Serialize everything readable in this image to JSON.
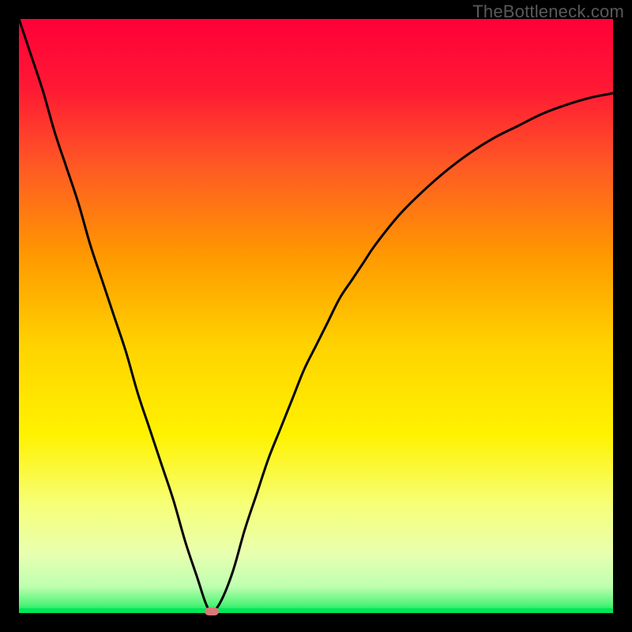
{
  "watermark": "TheBottleneck.com",
  "chart_data": {
    "type": "line",
    "title": "",
    "xlabel": "",
    "ylabel": "",
    "xlim": [
      0,
      100
    ],
    "ylim": [
      0,
      100
    ],
    "grid": false,
    "series": [
      {
        "name": "bottleneck-curve",
        "x": [
          0,
          2,
          4,
          6,
          8,
          10,
          12,
          14,
          16,
          18,
          20,
          22,
          24,
          26,
          28,
          30,
          31.5,
          32.5,
          34,
          36,
          38,
          40,
          42,
          44,
          46,
          48,
          50,
          52,
          54,
          56,
          58,
          60,
          64,
          68,
          72,
          76,
          80,
          84,
          88,
          92,
          96,
          100
        ],
        "y": [
          100,
          94,
          88,
          81,
          75,
          69,
          62,
          56,
          50,
          44,
          37,
          31,
          25,
          19,
          12,
          6,
          1.5,
          0.2,
          2,
          7,
          14,
          20,
          26,
          31,
          36,
          41,
          45,
          49,
          53,
          56,
          59,
          62,
          67,
          71,
          74.5,
          77.5,
          80,
          82,
          84,
          85.5,
          86.7,
          87.5
        ]
      }
    ],
    "gradient_stops": [
      {
        "pos": 0.0,
        "color": "#ff0038"
      },
      {
        "pos": 0.12,
        "color": "#ff1a34"
      },
      {
        "pos": 0.25,
        "color": "#ff5a24"
      },
      {
        "pos": 0.4,
        "color": "#ff9900"
      },
      {
        "pos": 0.55,
        "color": "#ffd300"
      },
      {
        "pos": 0.7,
        "color": "#fff200"
      },
      {
        "pos": 0.82,
        "color": "#f6ff7a"
      },
      {
        "pos": 0.9,
        "color": "#e8ffb0"
      },
      {
        "pos": 0.955,
        "color": "#bfffb0"
      },
      {
        "pos": 0.985,
        "color": "#55f47a"
      },
      {
        "pos": 1.0,
        "color": "#00e756"
      }
    ],
    "minimum_marker": {
      "x": 32.5,
      "y": 0.2
    }
  }
}
